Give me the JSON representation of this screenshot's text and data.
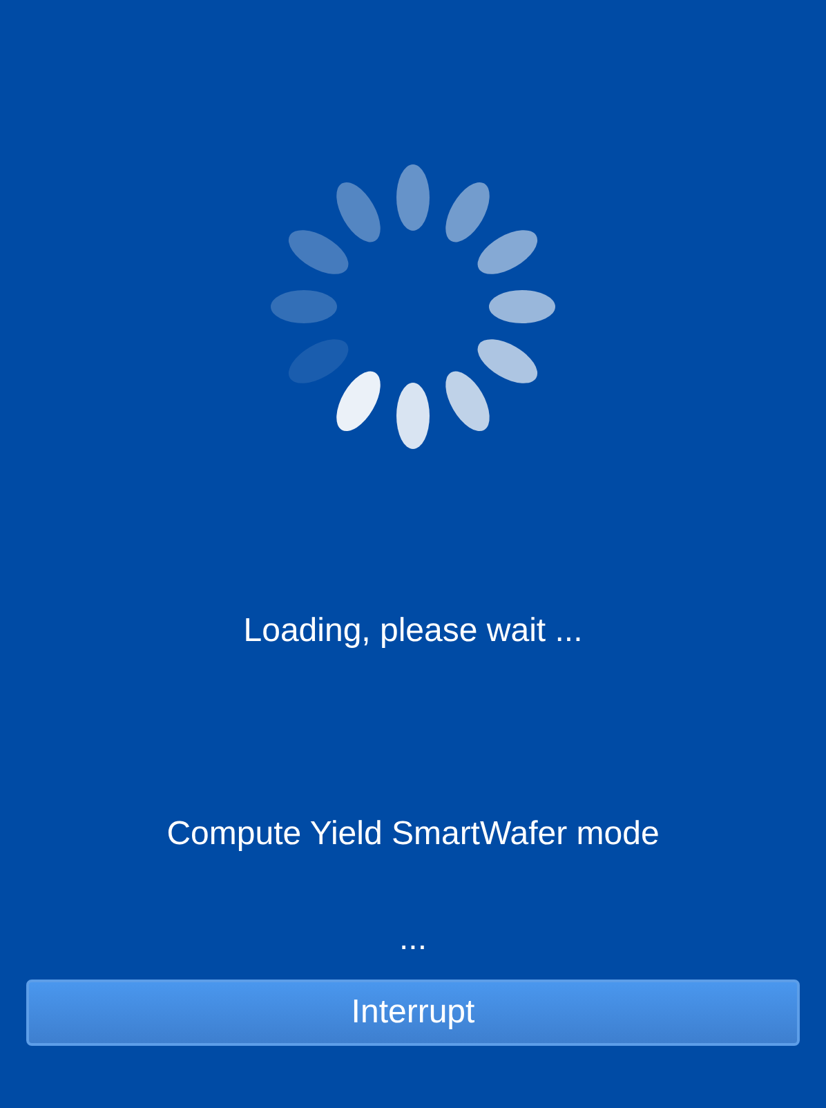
{
  "message": "Loading, please wait ...",
  "task": "Compute Yield SmartWafer mode",
  "progress_text": "...",
  "buttons": [
    {
      "label": "Interrupt"
    }
  ]
}
